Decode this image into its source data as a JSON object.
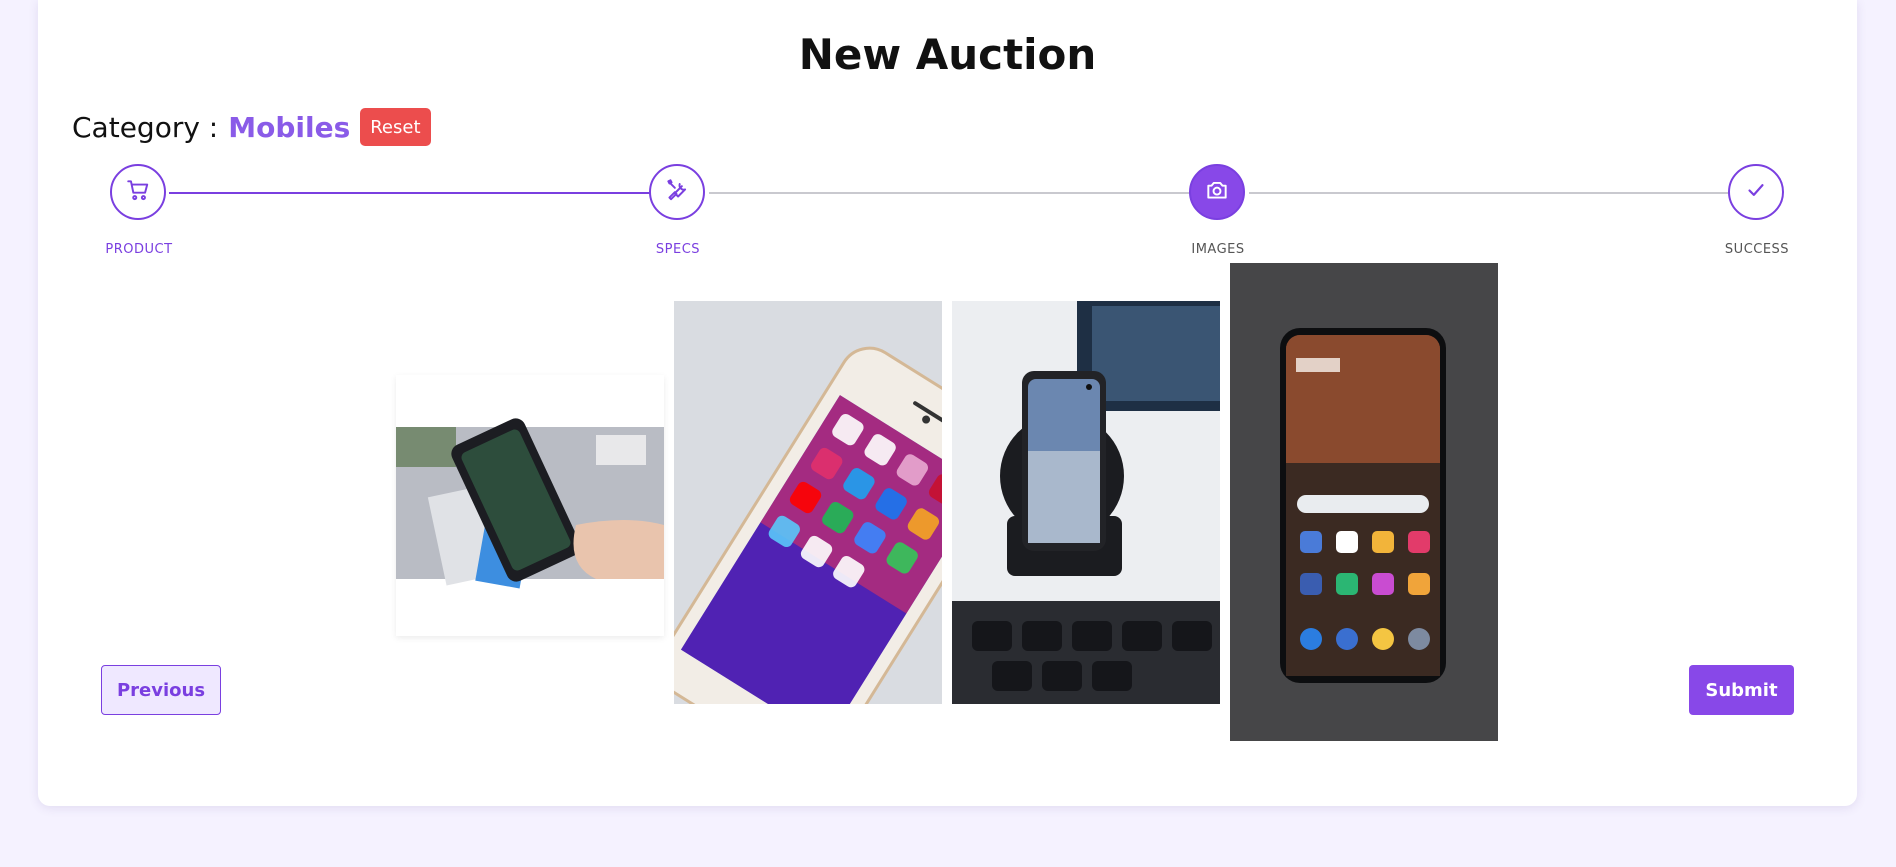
{
  "page": {
    "title": "New Auction"
  },
  "category": {
    "label": "Category :",
    "value": "Mobiles",
    "reset_label": "Reset"
  },
  "steps": [
    {
      "label": "PRODUCT",
      "icon": "cart-icon",
      "state": "done"
    },
    {
      "label": "SPECS",
      "icon": "tools-icon",
      "state": "done"
    },
    {
      "label": "IMAGES",
      "icon": "camera-icon",
      "state": "active"
    },
    {
      "label": "SUCCESS",
      "icon": "check-icon",
      "state": "pending"
    }
  ],
  "images": [
    {
      "name": "phone-in-hand-photo"
    },
    {
      "name": "iphone-home-screen-photo"
    },
    {
      "name": "phone-on-wireless-charger-photo"
    },
    {
      "name": "android-phone-photo"
    }
  ],
  "actions": {
    "previous_label": "Previous",
    "submit_label": "Submit"
  },
  "colors": {
    "accent": "#8848e8",
    "danger": "#ec4d4d",
    "background": "#f5f2ff"
  }
}
